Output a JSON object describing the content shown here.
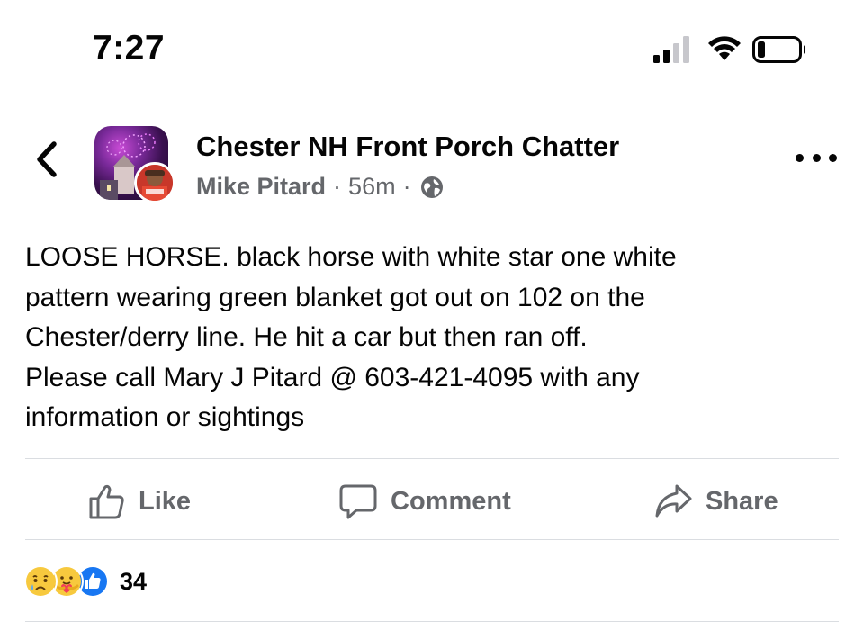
{
  "status_bar": {
    "time": "7:27",
    "icons": [
      "cellular-signal-icon",
      "wifi-icon",
      "battery-icon"
    ]
  },
  "header": {
    "back_icon": "chevron-left-icon",
    "group_name": "Chester NH Front Porch Chatter",
    "author": "Mike Pitard",
    "separator": "·",
    "time_ago": "56m",
    "privacy_icon": "globe-icon",
    "more_icon": "ellipsis-icon"
  },
  "post": {
    "lines": [
      "LOOSE HORSE. black horse with white star one white",
      "pattern wearing green blanket got out on 102 on the",
      "Chester/derry line. He hit a car but then ran off.",
      "Please call Mary J Pitard @ 603-421-4095 with any",
      "information or sightings"
    ]
  },
  "actions": {
    "like_label": "Like",
    "comment_label": "Comment",
    "share_label": "Share"
  },
  "reactions": {
    "icons": [
      "sad-reaction-icon",
      "care-reaction-icon",
      "like-reaction-icon"
    ],
    "count": "34"
  },
  "colors": {
    "text_primary": "#050505",
    "text_secondary": "#65676b",
    "divider": "#dadde1",
    "like_blue": "#1877f2",
    "reaction_yellow": "#f7c93e"
  }
}
